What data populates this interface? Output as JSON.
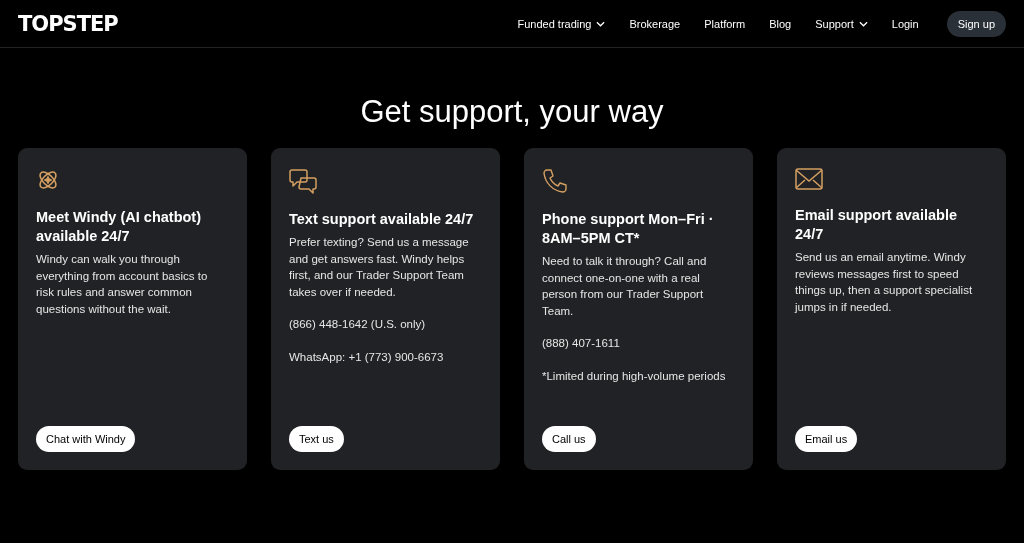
{
  "header": {
    "logo": "TOPSTEP",
    "nav": [
      {
        "label": "Funded trading",
        "dropdown": true
      },
      {
        "label": "Brokerage",
        "dropdown": false
      },
      {
        "label": "Platform",
        "dropdown": false
      },
      {
        "label": "Blog",
        "dropdown": false
      },
      {
        "label": "Support",
        "dropdown": true
      },
      {
        "label": "Login",
        "dropdown": false
      }
    ],
    "signup": "Sign up"
  },
  "heading": "Get support, your way",
  "cards": [
    {
      "kind": "sparkle",
      "title": "Meet Windy (AI chatbot) available 24/7",
      "paragraphs": [
        "Windy can walk you through everything from account basics to risk rules and answer common questions without the wait."
      ],
      "button": "Chat with Windy"
    },
    {
      "kind": "chat",
      "title": "Text support available 24/7",
      "paragraphs": [
        "Prefer texting? Send us a message and get answers fast. Windy helps first, and our Trader Support Team takes over if needed.",
        "(866) 448-1642 (U.S. only)",
        "WhatsApp: +1 (773) 900-6673"
      ],
      "button": "Text us"
    },
    {
      "kind": "phone",
      "title": "Phone support Mon–Fri · 8AM–5PM CT*",
      "paragraphs": [
        "Need to talk it through? Call and connect one-on-one with a real person from our Trader Support Team.",
        "(888) 407-1611",
        "*Limited during high-volume periods"
      ],
      "button": "Call us"
    },
    {
      "kind": "mail",
      "title": "Email support available 24/7",
      "paragraphs": [
        "Send us an email anytime. Windy reviews messages first to speed things up, then a support specialist jumps in if needed."
      ],
      "button": "Email us"
    }
  ]
}
